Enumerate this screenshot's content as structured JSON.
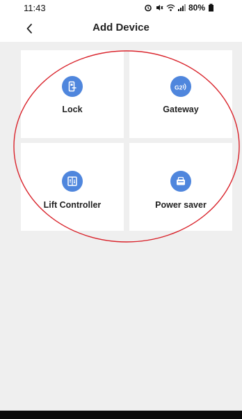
{
  "status_bar": {
    "time": "11:43",
    "battery": "80%"
  },
  "header": {
    "title": "Add Device"
  },
  "devices": [
    {
      "label": "Lock",
      "icon": "lock-icon"
    },
    {
      "label": "Gateway",
      "icon": "gateway-icon"
    },
    {
      "label": "Lift Controller",
      "icon": "lift-controller-icon"
    },
    {
      "label": "Power saver",
      "icon": "power-saver-icon"
    }
  ],
  "colors": {
    "accent": "#4f86dd",
    "annotation": "#d9232b",
    "background": "#efefef"
  }
}
